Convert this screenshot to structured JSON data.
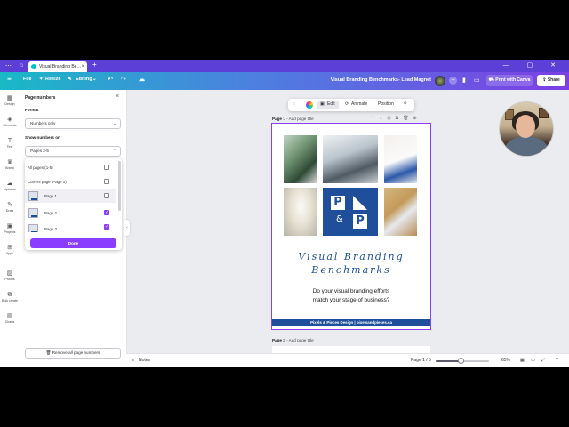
{
  "browser": {
    "tab_title": "Visual Branding Be…",
    "tab_close": "×",
    "new_tab": "+",
    "window_controls": "— ▢ ✕"
  },
  "header": {
    "menu_icon": "menu-icon",
    "file": "File",
    "resize": "Resize",
    "editing": "Editing",
    "doc_title": "Visual Branding Benchmarks- Lead Magnet",
    "print_with_canva": "Print with Canva",
    "share": "Share"
  },
  "rail": {
    "items": [
      {
        "label": "Design",
        "icon": "▦"
      },
      {
        "label": "Elements",
        "icon": "◈"
      },
      {
        "label": "Text",
        "icon": "T"
      },
      {
        "label": "Brand",
        "icon": "♛"
      },
      {
        "label": "Uploads",
        "icon": "☁"
      },
      {
        "label": "Draw",
        "icon": "✎"
      },
      {
        "label": "Projects",
        "icon": "▣"
      },
      {
        "label": "Apps",
        "icon": "⊞"
      },
      {
        "label": "Photos",
        "icon": "▨"
      },
      {
        "label": "Bulk create",
        "icon": "⧉"
      },
      {
        "label": "Charts",
        "icon": "▥"
      }
    ]
  },
  "panel": {
    "title": "Page numbers",
    "close": "×",
    "format_label": "Format",
    "format_value": "Numbers only",
    "show_label": "Show numbers on",
    "show_value": "Pages 2-5",
    "options": [
      {
        "label": "All pages (1-5)",
        "checked": false
      },
      {
        "label": "Current page (Page 1)",
        "checked": false
      },
      {
        "label": "Page 1",
        "checked": false
      },
      {
        "label": "Page 2",
        "checked": true
      },
      {
        "label": "Page 3",
        "checked": true
      }
    ],
    "done": "Done",
    "remove": "Remove all page numbers"
  },
  "toolbar": {
    "edit": "Edit",
    "animate": "Animate",
    "position": "Position"
  },
  "canvas": {
    "page1_label": "Page 1",
    "page1_title_placeholder": " - Add page title",
    "page2_label": "Page 2",
    "page2_title_placeholder": " - Add page title",
    "design": {
      "logo_p1": "P",
      "logo_amp": "&",
      "logo_p2": "P",
      "script_line1": "Visual Branding",
      "script_line2": "Benchmarks",
      "tagline_line1": "Do your visual branding efforts",
      "tagline_line2": "match your stage of business?",
      "footer": "Pixels & Pieces Design | pixelsandpieces.ca"
    }
  },
  "statusbar": {
    "notes": "Notes",
    "page_indicator": "Page 1 / 5",
    "zoom": "65%",
    "zoom_fraction": 0.48
  },
  "colors": {
    "accent": "#8b3dff",
    "brand_blue": "#1f4f9a"
  }
}
